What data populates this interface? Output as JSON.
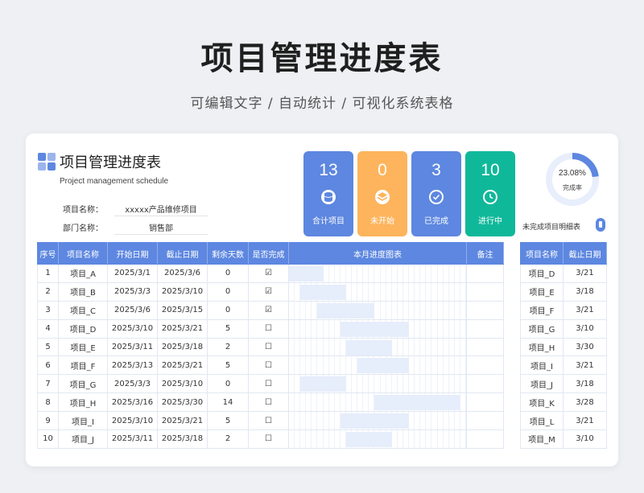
{
  "hero": {
    "title": "项目管理进度表",
    "subtitle": "可编辑文字 / 自动统计 / 可视化系统表格"
  },
  "sheet": {
    "title": "项目管理进度表",
    "subtitle": "Project management schedule",
    "project_label": "项目名称：",
    "project_value": "xxxxx产品维修项目",
    "dept_label": "部门名称：",
    "dept_value": "销售部"
  },
  "kpis": [
    {
      "value": "13",
      "label": "合计项目",
      "color": "#5d87e0",
      "icon": "database-icon"
    },
    {
      "value": "0",
      "label": "未开始",
      "color": "#fdb45c",
      "icon": "layers-icon"
    },
    {
      "value": "3",
      "label": "已完成",
      "color": "#5d87e0",
      "icon": "check-circle-icon"
    },
    {
      "value": "10",
      "label": "进行中",
      "color": "#10b89a",
      "icon": "clock-icon"
    }
  ],
  "completion": {
    "percent_text": "23.08%",
    "fraction": 0.2308,
    "label": "完成率",
    "color": "#5d87e0",
    "track_color": "#e8eefb"
  },
  "side_caption": "未完成项目明细表",
  "main_table": {
    "headers": [
      "序号",
      "项目名称",
      "开始日期",
      "截止日期",
      "剩余天数",
      "是否完成",
      "本月进度图表",
      "备注"
    ],
    "rows": [
      {
        "no": "1",
        "name": "项目_A",
        "start": "2025/3/1",
        "end": "2025/3/6",
        "remain": "0",
        "done": "☑",
        "s": 1,
        "e": 6
      },
      {
        "no": "2",
        "name": "项目_B",
        "start": "2025/3/3",
        "end": "2025/3/10",
        "remain": "0",
        "done": "☑",
        "s": 3,
        "e": 10
      },
      {
        "no": "3",
        "name": "项目_C",
        "start": "2025/3/6",
        "end": "2025/3/15",
        "remain": "0",
        "done": "☑",
        "s": 6,
        "e": 15
      },
      {
        "no": "4",
        "name": "项目_D",
        "start": "2025/3/10",
        "end": "2025/3/21",
        "remain": "5",
        "done": "☐",
        "s": 10,
        "e": 21
      },
      {
        "no": "5",
        "name": "项目_E",
        "start": "2025/3/11",
        "end": "2025/3/18",
        "remain": "2",
        "done": "☐",
        "s": 11,
        "e": 18
      },
      {
        "no": "6",
        "name": "项目_F",
        "start": "2025/3/13",
        "end": "2025/3/21",
        "remain": "5",
        "done": "☐",
        "s": 13,
        "e": 21
      },
      {
        "no": "7",
        "name": "项目_G",
        "start": "2025/3/3",
        "end": "2025/3/10",
        "remain": "0",
        "done": "☐",
        "s": 3,
        "e": 10
      },
      {
        "no": "8",
        "name": "项目_H",
        "start": "2025/3/16",
        "end": "2025/3/30",
        "remain": "14",
        "done": "☐",
        "s": 16,
        "e": 30
      },
      {
        "no": "9",
        "name": "项目_I",
        "start": "2025/3/10",
        "end": "2025/3/21",
        "remain": "5",
        "done": "☐",
        "s": 10,
        "e": 21
      },
      {
        "no": "10",
        "name": "项目_J",
        "start": "2025/3/11",
        "end": "2025/3/18",
        "remain": "2",
        "done": "☐",
        "s": 11,
        "e": 18
      }
    ]
  },
  "side_table": {
    "headers": [
      "项目名称",
      "截止日期"
    ],
    "rows": [
      [
        "项目_D",
        "3/21"
      ],
      [
        "项目_E",
        "3/18"
      ],
      [
        "项目_F",
        "3/21"
      ],
      [
        "项目_G",
        "3/10"
      ],
      [
        "项目_H",
        "3/30"
      ],
      [
        "项目_I",
        "3/21"
      ],
      [
        "项目_J",
        "3/18"
      ],
      [
        "项目_K",
        "3/28"
      ],
      [
        "项目_L",
        "3/21"
      ],
      [
        "项目_M",
        "3/10"
      ]
    ]
  }
}
